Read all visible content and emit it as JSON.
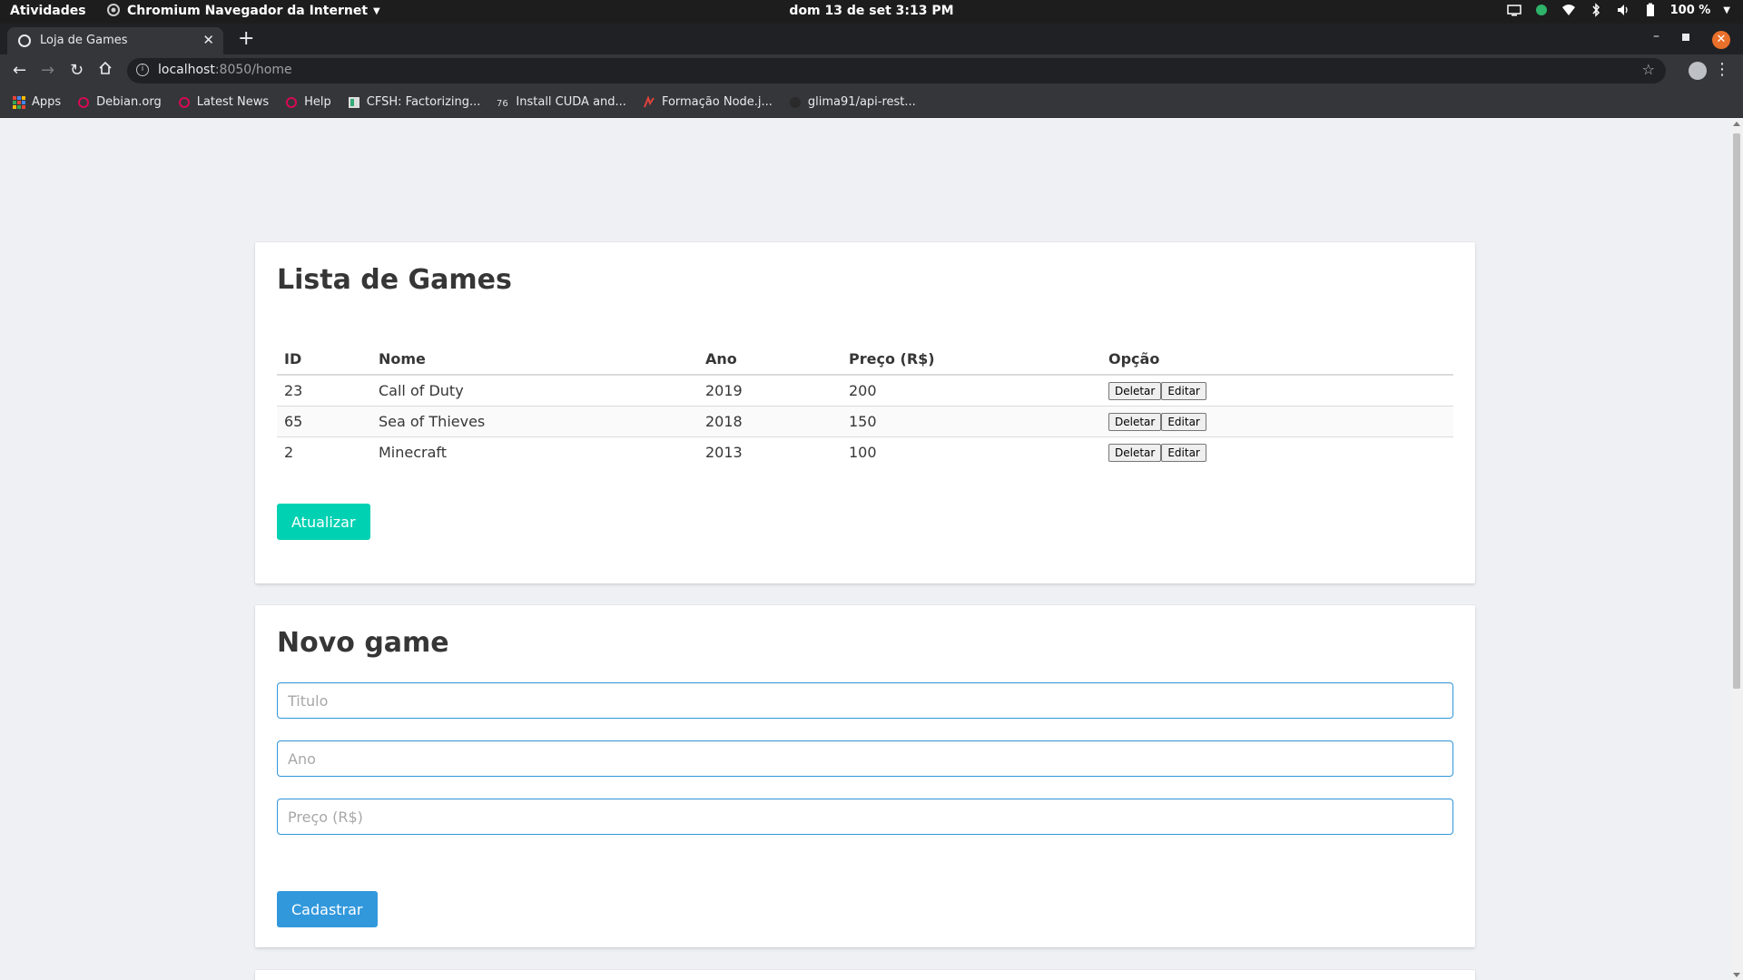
{
  "topbar": {
    "activities": "Atividades",
    "app_name": "Chromium Navegador da Internet",
    "clock": "dom 13 de set   3:13 PM",
    "battery": "100 %"
  },
  "browser": {
    "tab_title": "Loja de Games",
    "url_host": "localhost",
    "url_rest": ":8050/home",
    "bookmarks": [
      {
        "label": "Apps",
        "icon": "apps-grid-icon"
      },
      {
        "label": "Debian.org",
        "icon": "debian-swirl-icon"
      },
      {
        "label": "Latest News",
        "icon": "debian-swirl-icon"
      },
      {
        "label": "Help",
        "icon": "debian-swirl-icon"
      },
      {
        "label": "CFSH: Factorizing...",
        "icon": "site-favicon-icon"
      },
      {
        "label": "Install CUDA and...",
        "icon": "site-favicon-icon"
      },
      {
        "label": "Formação Node.j...",
        "icon": "site-favicon-icon"
      },
      {
        "label": "glima91/api-rest...",
        "icon": "github-icon"
      }
    ]
  },
  "games_list": {
    "title": "Lista de Games",
    "headers": [
      "ID",
      "Nome",
      "Ano",
      "Preço (R$)",
      "Opção"
    ],
    "rows": [
      {
        "id": "23",
        "nome": "Call of Duty",
        "ano": "2019",
        "preco": "200"
      },
      {
        "id": "65",
        "nome": "Sea of Thieves",
        "ano": "2018",
        "preco": "150"
      },
      {
        "id": "2",
        "nome": "Minecraft",
        "ano": "2013",
        "preco": "100"
      }
    ],
    "delete_label": "Deletar",
    "edit_label": "Editar",
    "refresh_label": "Atualizar"
  },
  "new_game": {
    "title": "Novo game",
    "title_placeholder": "Titulo",
    "year_placeholder": "Ano",
    "price_placeholder": "Preço (R$)",
    "submit_label": "Cadastrar"
  },
  "colors": {
    "accent_teal": "#00d1b2",
    "accent_blue": "#3298dc",
    "firefox_close": "#e9702b"
  }
}
